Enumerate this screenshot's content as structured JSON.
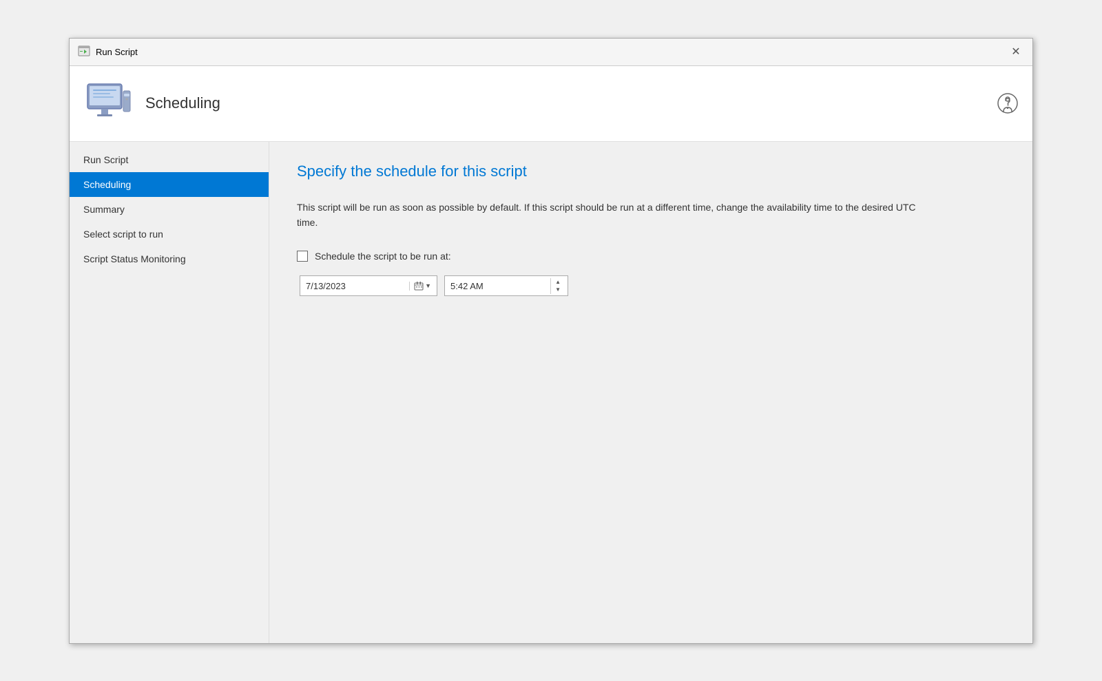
{
  "titleBar": {
    "title": "Run Script",
    "closeLabel": "✕"
  },
  "header": {
    "title": "Scheduling"
  },
  "sidebar": {
    "items": [
      {
        "id": "run-script",
        "label": "Run Script",
        "active": false
      },
      {
        "id": "scheduling",
        "label": "Scheduling",
        "active": true
      },
      {
        "id": "summary",
        "label": "Summary",
        "active": false
      },
      {
        "id": "select-script",
        "label": "Select script to run",
        "active": false
      },
      {
        "id": "script-status",
        "label": "Script Status Monitoring",
        "active": false
      }
    ]
  },
  "content": {
    "heading": "Specify the schedule for this script",
    "description": "This script will be run as soon as possible by default. If this script should be run at a different time, change the availability time to the desired UTC time.",
    "scheduleCheckboxLabel": "Schedule the script to be run at:",
    "dateValue": "7/13/2023",
    "timeValue": "5:42 AM"
  },
  "icons": {
    "calendar": "📅",
    "spinUp": "▲",
    "spinDown": "▼",
    "chevronDown": "▼",
    "help": "🗨",
    "close": "✕"
  },
  "colors": {
    "activeNavBg": "#0078d4",
    "headingColor": "#0078d4"
  }
}
